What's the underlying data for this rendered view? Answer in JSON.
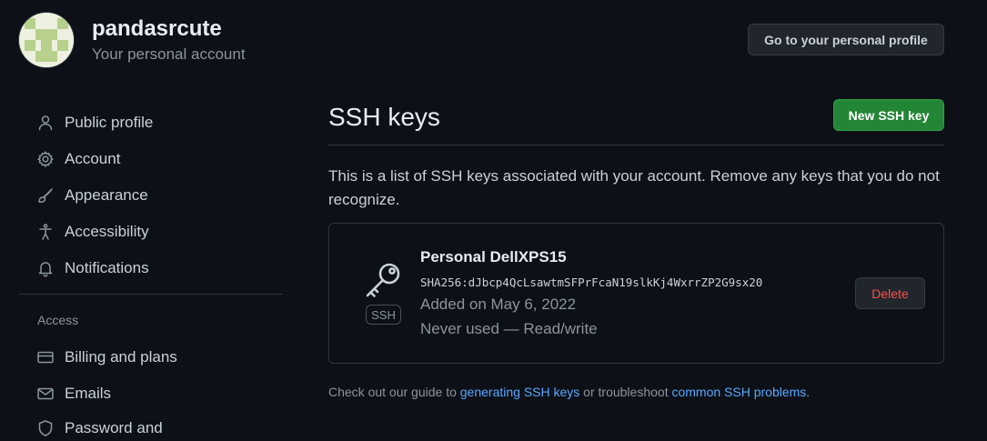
{
  "user": {
    "name": "pandasrcute",
    "subtitle": "Your personal account",
    "profile_button": "Go to your personal profile"
  },
  "sidebar": {
    "items": [
      {
        "label": "Public profile",
        "icon": "person-icon"
      },
      {
        "label": "Account",
        "icon": "gear-icon"
      },
      {
        "label": "Appearance",
        "icon": "paintbrush-icon"
      },
      {
        "label": "Accessibility",
        "icon": "accessibility-icon"
      },
      {
        "label": "Notifications",
        "icon": "bell-icon"
      }
    ],
    "access_heading": "Access",
    "access_items": [
      {
        "label": "Billing and plans",
        "icon": "credit-card-icon"
      },
      {
        "label": "Emails",
        "icon": "mail-icon"
      },
      {
        "label": "Password and",
        "icon": "shield-lock-icon"
      }
    ]
  },
  "main": {
    "title": "SSH keys",
    "new_button": "New SSH key",
    "intro": "This is a list of SSH keys associated with your account. Remove any keys that you do not recognize.",
    "key": {
      "badge": "SSH",
      "title": "Personal DellXPS15",
      "fingerprint": "SHA256:dJbcp4QcLsawtmSFPrFcaN19slkKj4WxrrZP2G9sx20",
      "added": "Added on May 6, 2022",
      "usage": "Never used — Read/write",
      "delete_button": "Delete"
    },
    "footer": {
      "prefix": "Check out our guide to ",
      "link1": "generating SSH keys",
      "middle": " or troubleshoot ",
      "link2": "common SSH problems",
      "suffix": "."
    }
  },
  "colors": {
    "background": "#0d1117",
    "primary_button": "#238636",
    "danger_text": "#f85149",
    "link": "#58a6ff",
    "muted_text": "#8b949e",
    "border": "#30363d"
  }
}
